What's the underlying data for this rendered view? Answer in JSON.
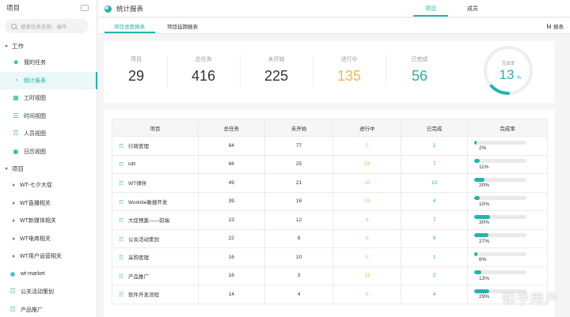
{
  "sidebar": {
    "title": "项目",
    "search_placeholder": "搜索任务名称、编号",
    "section_work": "工作",
    "work_items": [
      {
        "label": "我的任务"
      },
      {
        "label": "统计报表"
      },
      {
        "label": "工时视图"
      },
      {
        "label": "时间视图"
      },
      {
        "label": "人员视图"
      },
      {
        "label": "日历视图"
      }
    ],
    "section_project": "项目",
    "project_groups": [
      {
        "label": "WT-七夕大促"
      },
      {
        "label": "WT直播相关"
      },
      {
        "label": "WT新媒体相关"
      },
      {
        "label": "WT电商相关"
      },
      {
        "label": "WT用户运营相关"
      }
    ],
    "project_items": [
      {
        "label": "wt-market"
      },
      {
        "label": "公关活动策划"
      },
      {
        "label": "产品推广"
      }
    ]
  },
  "header": {
    "title": "统计报表",
    "tabs": [
      {
        "label": "项目"
      },
      {
        "label": "成员"
      }
    ]
  },
  "subheader": {
    "tabs": [
      {
        "label": "项目进度报表"
      },
      {
        "label": "项目延期报表"
      }
    ],
    "report_label": "报表"
  },
  "stats": {
    "project": {
      "label": "项目",
      "value": "29"
    },
    "total": {
      "label": "总任务",
      "value": "416"
    },
    "not_started": {
      "label": "未开始",
      "value": "225"
    },
    "in_progress": {
      "label": "进行中",
      "value": "135"
    },
    "done": {
      "label": "已完成",
      "value": "56"
    },
    "completion": {
      "label": "完成率",
      "value": "13",
      "unit": "%",
      "fraction": 0.13
    }
  },
  "table": {
    "headers": [
      "项目",
      "总任务",
      "未开始",
      "进行中",
      "已完成",
      "完成率"
    ],
    "rows": [
      {
        "name": "行政管理",
        "total": "84",
        "not_started": "77",
        "in_progress": "5",
        "done": "2",
        "rate": "2%",
        "pct": 2
      },
      {
        "name": "HR",
        "total": "66",
        "not_started": "25",
        "in_progress": "34",
        "done": "7",
        "rate": "11%",
        "pct": 11
      },
      {
        "name": "WT律所",
        "total": "49",
        "not_started": "21",
        "in_progress": "18",
        "done": "10",
        "rate": "20%",
        "pct": 20
      },
      {
        "name": "Worktile敏捷开发",
        "total": "39",
        "not_started": "16",
        "in_progress": "19",
        "done": "4",
        "rate": "10%",
        "pct": 10
      },
      {
        "name": "大促预案——前端",
        "total": "23",
        "not_started": "12",
        "in_progress": "4",
        "done": "7",
        "rate": "30%",
        "pct": 30
      },
      {
        "name": "公关活动策划",
        "total": "22",
        "not_started": "8",
        "in_progress": "8",
        "done": "6",
        "rate": "27%",
        "pct": 27
      },
      {
        "name": "采购管理",
        "total": "16",
        "not_started": "10",
        "in_progress": "5",
        "done": "1",
        "rate": "6%",
        "pct": 6
      },
      {
        "name": "产品推广",
        "total": "16",
        "not_started": "3",
        "in_progress": "11",
        "done": "2",
        "rate": "13%",
        "pct": 13
      },
      {
        "name": "软件开发流程",
        "total": "14",
        "not_started": "4",
        "in_progress": "6",
        "done": "4",
        "rate": "29%",
        "pct": 29
      }
    ]
  },
  "watermark": "知乎用户",
  "colors": {
    "accent": "#22b4ad",
    "in_progress": "#f5b94a"
  }
}
